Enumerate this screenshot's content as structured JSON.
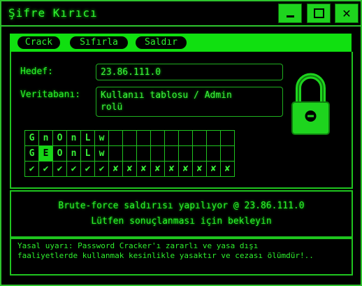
{
  "window": {
    "title": "Şifre Kırıcı",
    "accent": "#1ed41e"
  },
  "tabs": [
    {
      "label": "Crack"
    },
    {
      "label": "Sıfırla"
    },
    {
      "label": "Saldır"
    }
  ],
  "form": {
    "target_label": "Hedef:",
    "target_value": "23.86.111.0",
    "db_label": "Veritabanı:",
    "db_value_line1": "Kullanıı tablosu / Admin",
    "db_value_line2": "rolü"
  },
  "grid": {
    "row1": [
      "G",
      "n",
      "O",
      "n",
      "L",
      "w",
      "",
      "",
      "",
      "",
      "",
      "",
      "",
      "",
      ""
    ],
    "row2": [
      "G",
      "E",
      "O",
      "n",
      "L",
      "w",
      "",
      "",
      "",
      "",
      "",
      "",
      "",
      "",
      ""
    ],
    "row3": [
      "✔",
      "✔",
      "✔",
      "✔",
      "✔",
      "✔",
      "✘",
      "✘",
      "✘",
      "✘",
      "✘",
      "✘",
      "✘",
      "✘",
      "✘"
    ],
    "highlight": "row2 col2"
  },
  "status": {
    "line1": "Brute-force saldırısı yapılıyor @ 23.86.111.0",
    "line2": "Lütfen sonuçlanması için bekleyin"
  },
  "warning": {
    "line1": "Yasal uyarı: Password Cracker'ı zararlı ve yasa dışı",
    "line2": "faaliyetlerde kullanmak kesinlikle yasaktır ve cezası ölümdür!.."
  },
  "icons": {
    "lock": "padlock-icon"
  }
}
